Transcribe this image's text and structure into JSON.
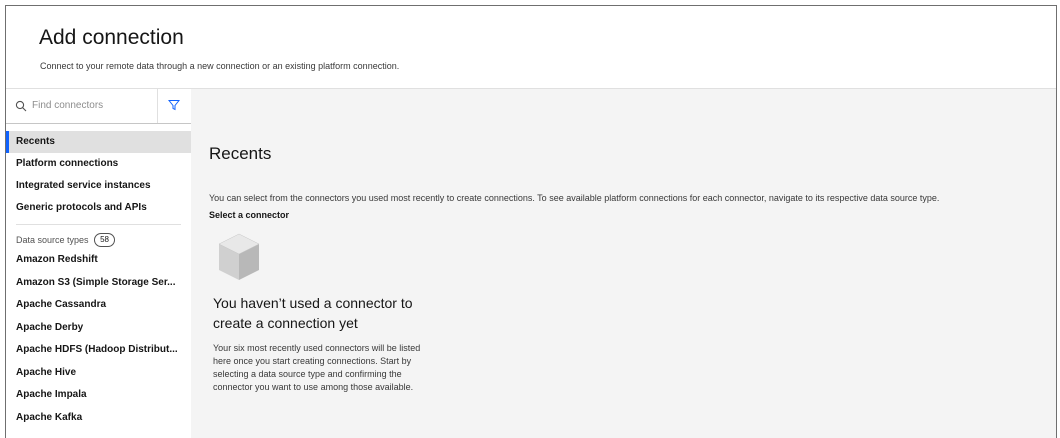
{
  "header": {
    "title": "Add connection",
    "subtitle": "Connect to your remote data through a new connection or an existing platform connection."
  },
  "search": {
    "placeholder": "Find connectors",
    "icon": "search-icon",
    "filter_icon": "filter-icon"
  },
  "nav": {
    "items": [
      {
        "label": "Recents",
        "active": true
      },
      {
        "label": "Platform connections"
      },
      {
        "label": "Integrated service instances"
      },
      {
        "label": "Generic protocols and APIs"
      }
    ]
  },
  "data_source_types": {
    "label": "Data source types",
    "count": "58",
    "items": [
      "Amazon Redshift",
      "Amazon S3 (Simple Storage Ser...",
      "Apache Cassandra",
      "Apache Derby",
      "Apache HDFS (Hadoop Distribut...",
      "Apache Hive",
      "Apache Impala",
      "Apache Kafka"
    ]
  },
  "main": {
    "title": "Recents",
    "description": "You can select from the connectors you used most recently to create connections. To see available platform connections for each connector, navigate to its respective data source type.",
    "select_label": "Select a connector",
    "empty_state": {
      "icon": "box-icon",
      "title": "You haven’t used a connector to create a connection yet",
      "body": "Your six most recently used connectors will be listed here once you start creating connections. Start by selecting a data source type and confirming the connector you want to use among those available."
    }
  },
  "colors": {
    "accent": "#0f62fe",
    "main_bg": "#f4f4f4",
    "active_nav_bg": "#e0e0e0"
  }
}
